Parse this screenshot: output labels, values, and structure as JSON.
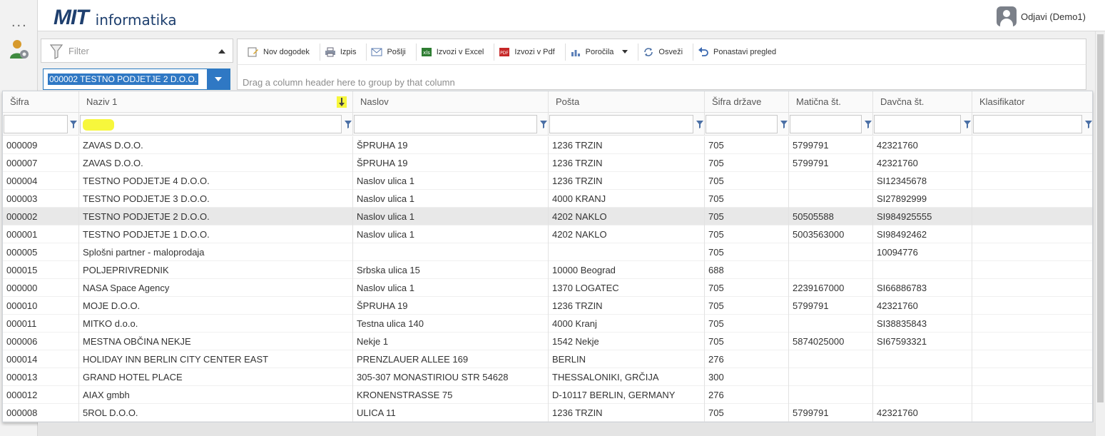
{
  "app": {
    "logo_mark": "MIT",
    "logo_text": "informatika",
    "menu_dots": "...",
    "menu_dots_icon": "ellipsis-icon",
    "user_settings_icon": "user-gear-icon"
  },
  "user": {
    "logout_label": "Odjavi (Demo1)",
    "avatar_icon": "user-avatar-icon"
  },
  "filter": {
    "label": "Filter",
    "icon": "funnel-icon",
    "selected_partner": "000002 TESTNO PODJETJE 2 D.O.O."
  },
  "toolbar": {
    "items": [
      {
        "label": "Nov dogodek",
        "icon": "new-event-icon"
      },
      {
        "label": "Izpis",
        "icon": "printer-icon"
      },
      {
        "label": "Pošlji",
        "icon": "envelope-icon"
      },
      {
        "label": "Izvozi v Excel",
        "icon": "excel-icon"
      },
      {
        "label": "Izvozi v Pdf",
        "icon": "pdf-icon"
      },
      {
        "label": "Poročila",
        "icon": "bar-chart-icon"
      },
      {
        "label": "Osveži",
        "icon": "refresh-icon"
      },
      {
        "label": "Ponastavi pregled",
        "icon": "undo-icon"
      }
    ]
  },
  "group_bar": {
    "placeholder": "Drag a column header here to group by that column"
  },
  "grid": {
    "columns": [
      "Šifra",
      "Naziv 1",
      "Naslov",
      "Pošta",
      "Šifra države",
      "Matična št.",
      "Davčna št.",
      "Klasifikator"
    ],
    "sorted_column": "Naziv 1",
    "selected_row": 4,
    "rows": [
      [
        "000009",
        "ZAVAS D.O.O.",
        "ŠPRUHA 19",
        "1236 TRZIN",
        "705",
        "5799791",
        "42321760",
        ""
      ],
      [
        "000007",
        "ZAVAS D.O.O.",
        "ŠPRUHA 19",
        "1236 TRZIN",
        "705",
        "5799791",
        "42321760",
        ""
      ],
      [
        "000004",
        "TESTNO PODJETJE 4 D.O.O.",
        "Naslov ulica 1",
        "1236 TRZIN",
        "705",
        "",
        "SI12345678",
        ""
      ],
      [
        "000003",
        "TESTNO PODJETJE 3 D.O.O.",
        "Naslov ulica 1",
        "4000 KRANJ",
        "705",
        "",
        "SI27892999",
        ""
      ],
      [
        "000002",
        "TESTNO PODJETJE 2 D.O.O.",
        "Naslov ulica 1",
        "4202 NAKLO",
        "705",
        "50505588",
        "SI984925555",
        ""
      ],
      [
        "000001",
        "TESTNO PODJETJE 1 D.O.O.",
        "Naslov ulica 1",
        "4202 NAKLO",
        "705",
        "5003563000",
        "SI98492462",
        ""
      ],
      [
        "000005",
        "Splošni partner - maloprodaja",
        "",
        "",
        "705",
        "",
        "10094776",
        ""
      ],
      [
        "000015",
        "POLJEPRIVREDNIK",
        "Srbska ulica 15",
        "10000 Beograd",
        "688",
        "",
        "",
        ""
      ],
      [
        "000000",
        "NASA Space Agency",
        "Naslov ulica 1",
        "1370 LOGATEC",
        "705",
        "2239167000",
        "SI66886783",
        ""
      ],
      [
        "000010",
        "MOJE D.O.O.",
        "ŠPRUHA 19",
        "1236 TRZIN",
        "705",
        "5799791",
        "42321760",
        ""
      ],
      [
        "000011",
        "MITKO d.o.o.",
        "Testna ulica 140",
        "4000 Kranj",
        "705",
        "",
        "SI38835843",
        ""
      ],
      [
        "000006",
        "MESTNA OBČINA NEKJE",
        "Nekje 1",
        "1542 Nekje",
        "705",
        "5874025000",
        "SI67593321",
        ""
      ],
      [
        "000014",
        "HOLIDAY INN BERLIN CITY CENTER EAST",
        "PRENZLAUER ALLEE 169",
        "BERLIN",
        "276",
        "",
        "",
        ""
      ],
      [
        "000013",
        "GRAND HOTEL PLACE",
        "305-307 MONASTIRIOU STR 54628",
        "THESSALONIKI, GRČIJA",
        "300",
        "",
        "",
        ""
      ],
      [
        "000012",
        "AIAX gmbh",
        "KRONENSTRASSE 75",
        "D-10117 BERLIN, GERMANY",
        "276",
        "",
        "",
        ""
      ],
      [
        "000008",
        "5ROL D.O.O.",
        "ULICA 11",
        "1236 TRZIN",
        "705",
        "5799791",
        "42321760",
        ""
      ]
    ]
  }
}
